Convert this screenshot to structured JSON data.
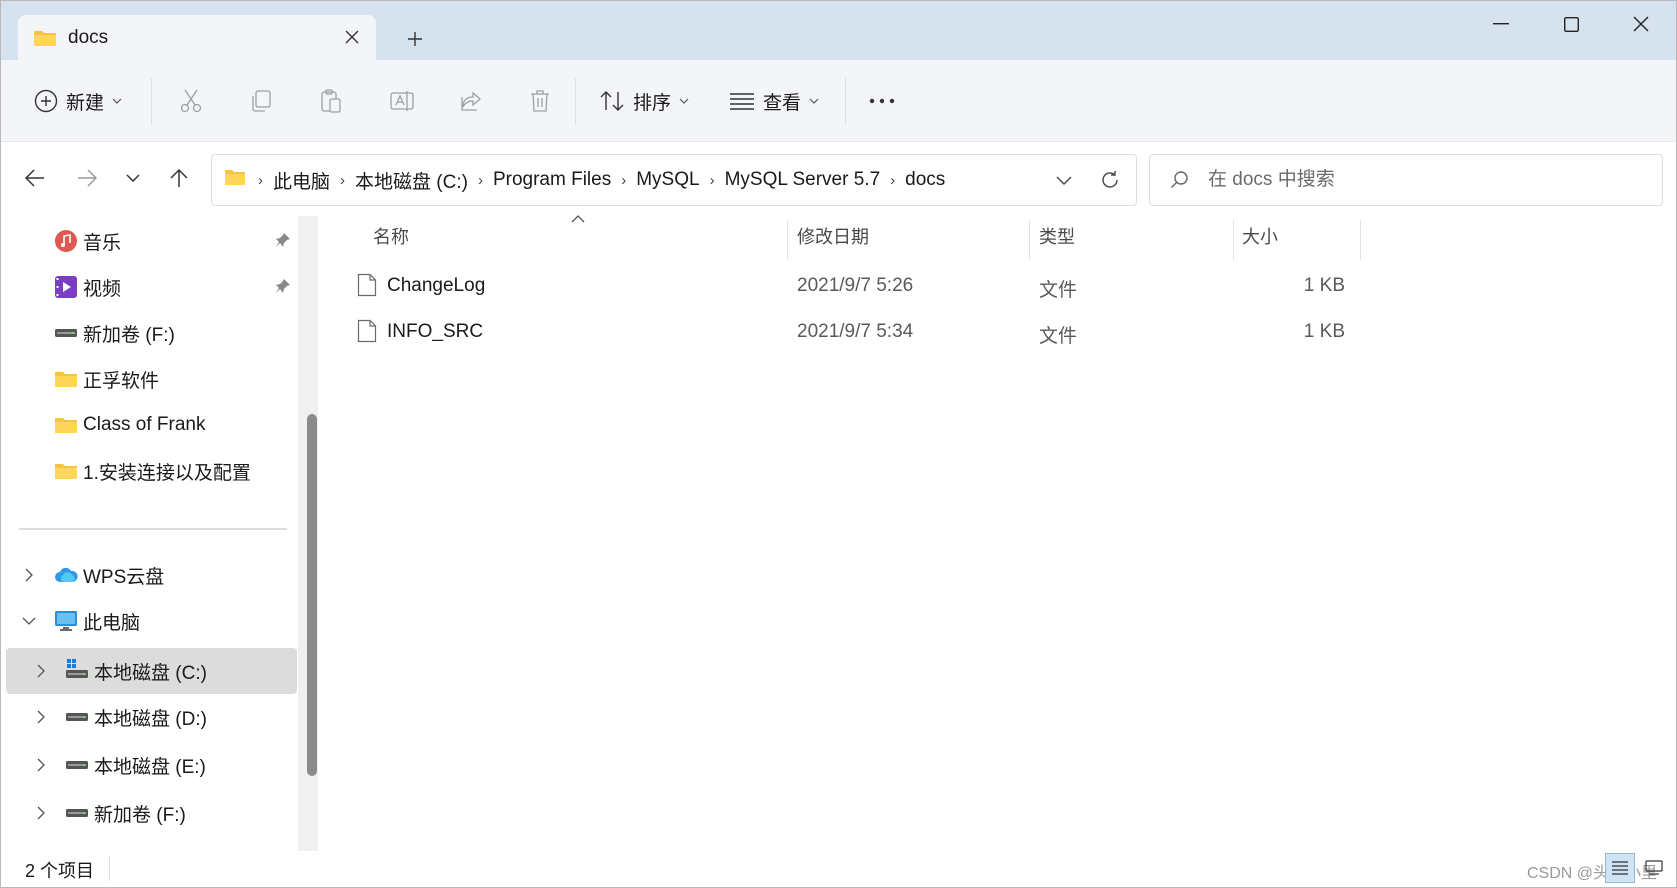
{
  "tab": {
    "title": "docs"
  },
  "window_controls": [
    "minimize",
    "maximize",
    "close"
  ],
  "toolbar": {
    "new_label": "新建",
    "sort_label": "排序",
    "view_label": "查看",
    "more_label": "···"
  },
  "address": {
    "crumbs": [
      "此电脑",
      "本地磁盘 (C:)",
      "Program Files",
      "MySQL",
      "MySQL Server 5.7",
      "docs"
    ]
  },
  "search": {
    "placeholder": "在 docs 中搜索"
  },
  "sidebar": {
    "quick_access": [
      {
        "label": "音乐",
        "icon": "music-icon",
        "pinned": true
      },
      {
        "label": "视频",
        "icon": "video-icon",
        "pinned": true
      },
      {
        "label": "新加卷 (F:)",
        "icon": "drive-icon",
        "pinned": false
      },
      {
        "label": "正孚软件",
        "icon": "folder-icon",
        "pinned": false
      },
      {
        "label": "Class of Frank",
        "icon": "folder-icon",
        "pinned": false
      },
      {
        "label": "1.安装连接以及配置",
        "icon": "folder-icon",
        "pinned": false
      }
    ],
    "tree": [
      {
        "label": "WPS云盘",
        "icon": "cloud-icon",
        "expanded": false
      },
      {
        "label": "此电脑",
        "icon": "computer-icon",
        "expanded": true
      },
      {
        "label": "本地磁盘 (C:)",
        "icon": "windows-drive-icon",
        "selected": true
      },
      {
        "label": "本地磁盘 (D:)",
        "icon": "drive-icon"
      },
      {
        "label": "本地磁盘 (E:)",
        "icon": "drive-icon"
      },
      {
        "label": "新加卷 (F:)",
        "icon": "drive-icon"
      }
    ]
  },
  "columns": {
    "name": "名称",
    "date": "修改日期",
    "type": "类型",
    "size": "大小"
  },
  "files": [
    {
      "name": "ChangeLog",
      "date": "2021/9/7 5:26",
      "type": "文件",
      "size": "1 KB"
    },
    {
      "name": "INFO_SRC",
      "date": "2021/9/7 5:34",
      "type": "文件",
      "size": "1 KB"
    }
  ],
  "status": {
    "count_text": "2 个项目",
    "watermark": "CSDN @头基小里"
  },
  "colors": {
    "titlebar": "#d6e3ef",
    "commandbar": "#f3f5f8",
    "selected_nav": "#dcdcdc",
    "folder_yellow": "#f5c542"
  }
}
